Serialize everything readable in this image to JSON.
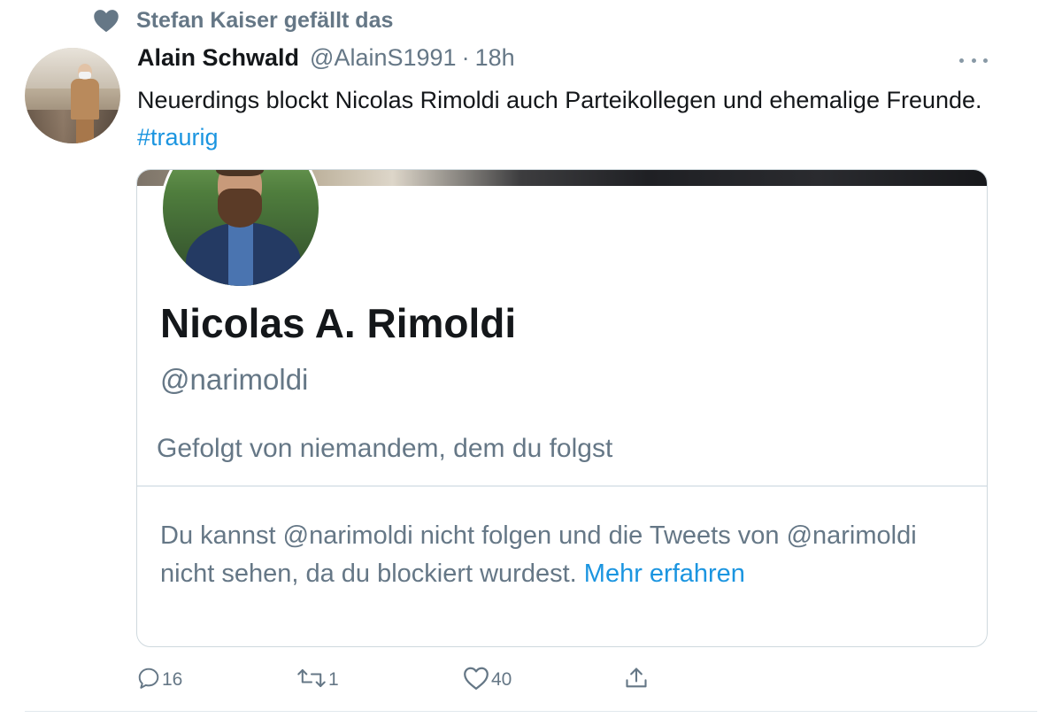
{
  "social_context": {
    "icon": "heart-icon",
    "text": "Stefan Kaiser gefällt das"
  },
  "tweet": {
    "author_name": "Alain Schwald",
    "author_handle": "@AlainS1991",
    "separator": "·",
    "time": "18h",
    "text_main": "Neuerdings blockt Nicolas Rimoldi auch Parteikollegen und ehemalige Freunde. ",
    "hashtag": "#traurig"
  },
  "embedded_profile": {
    "display_name": "Nicolas A. Rimoldi",
    "handle": "@narimoldi",
    "followed_by": "Gefolgt von niemandem, dem du folgst",
    "blocked_text": "Du kannst @narimoldi nicht folgen und die Tweets von @narimoldi nicht sehen, da du blockiert wurdest. ",
    "learn_more": "Mehr erfahren"
  },
  "actions": {
    "reply_count": "16",
    "retweet_count": "1",
    "like_count": "40"
  },
  "colors": {
    "text_primary": "#14171a",
    "text_secondary": "#657786",
    "link": "#1b95e0",
    "icon": "#657786",
    "border": "#cfd9de"
  }
}
